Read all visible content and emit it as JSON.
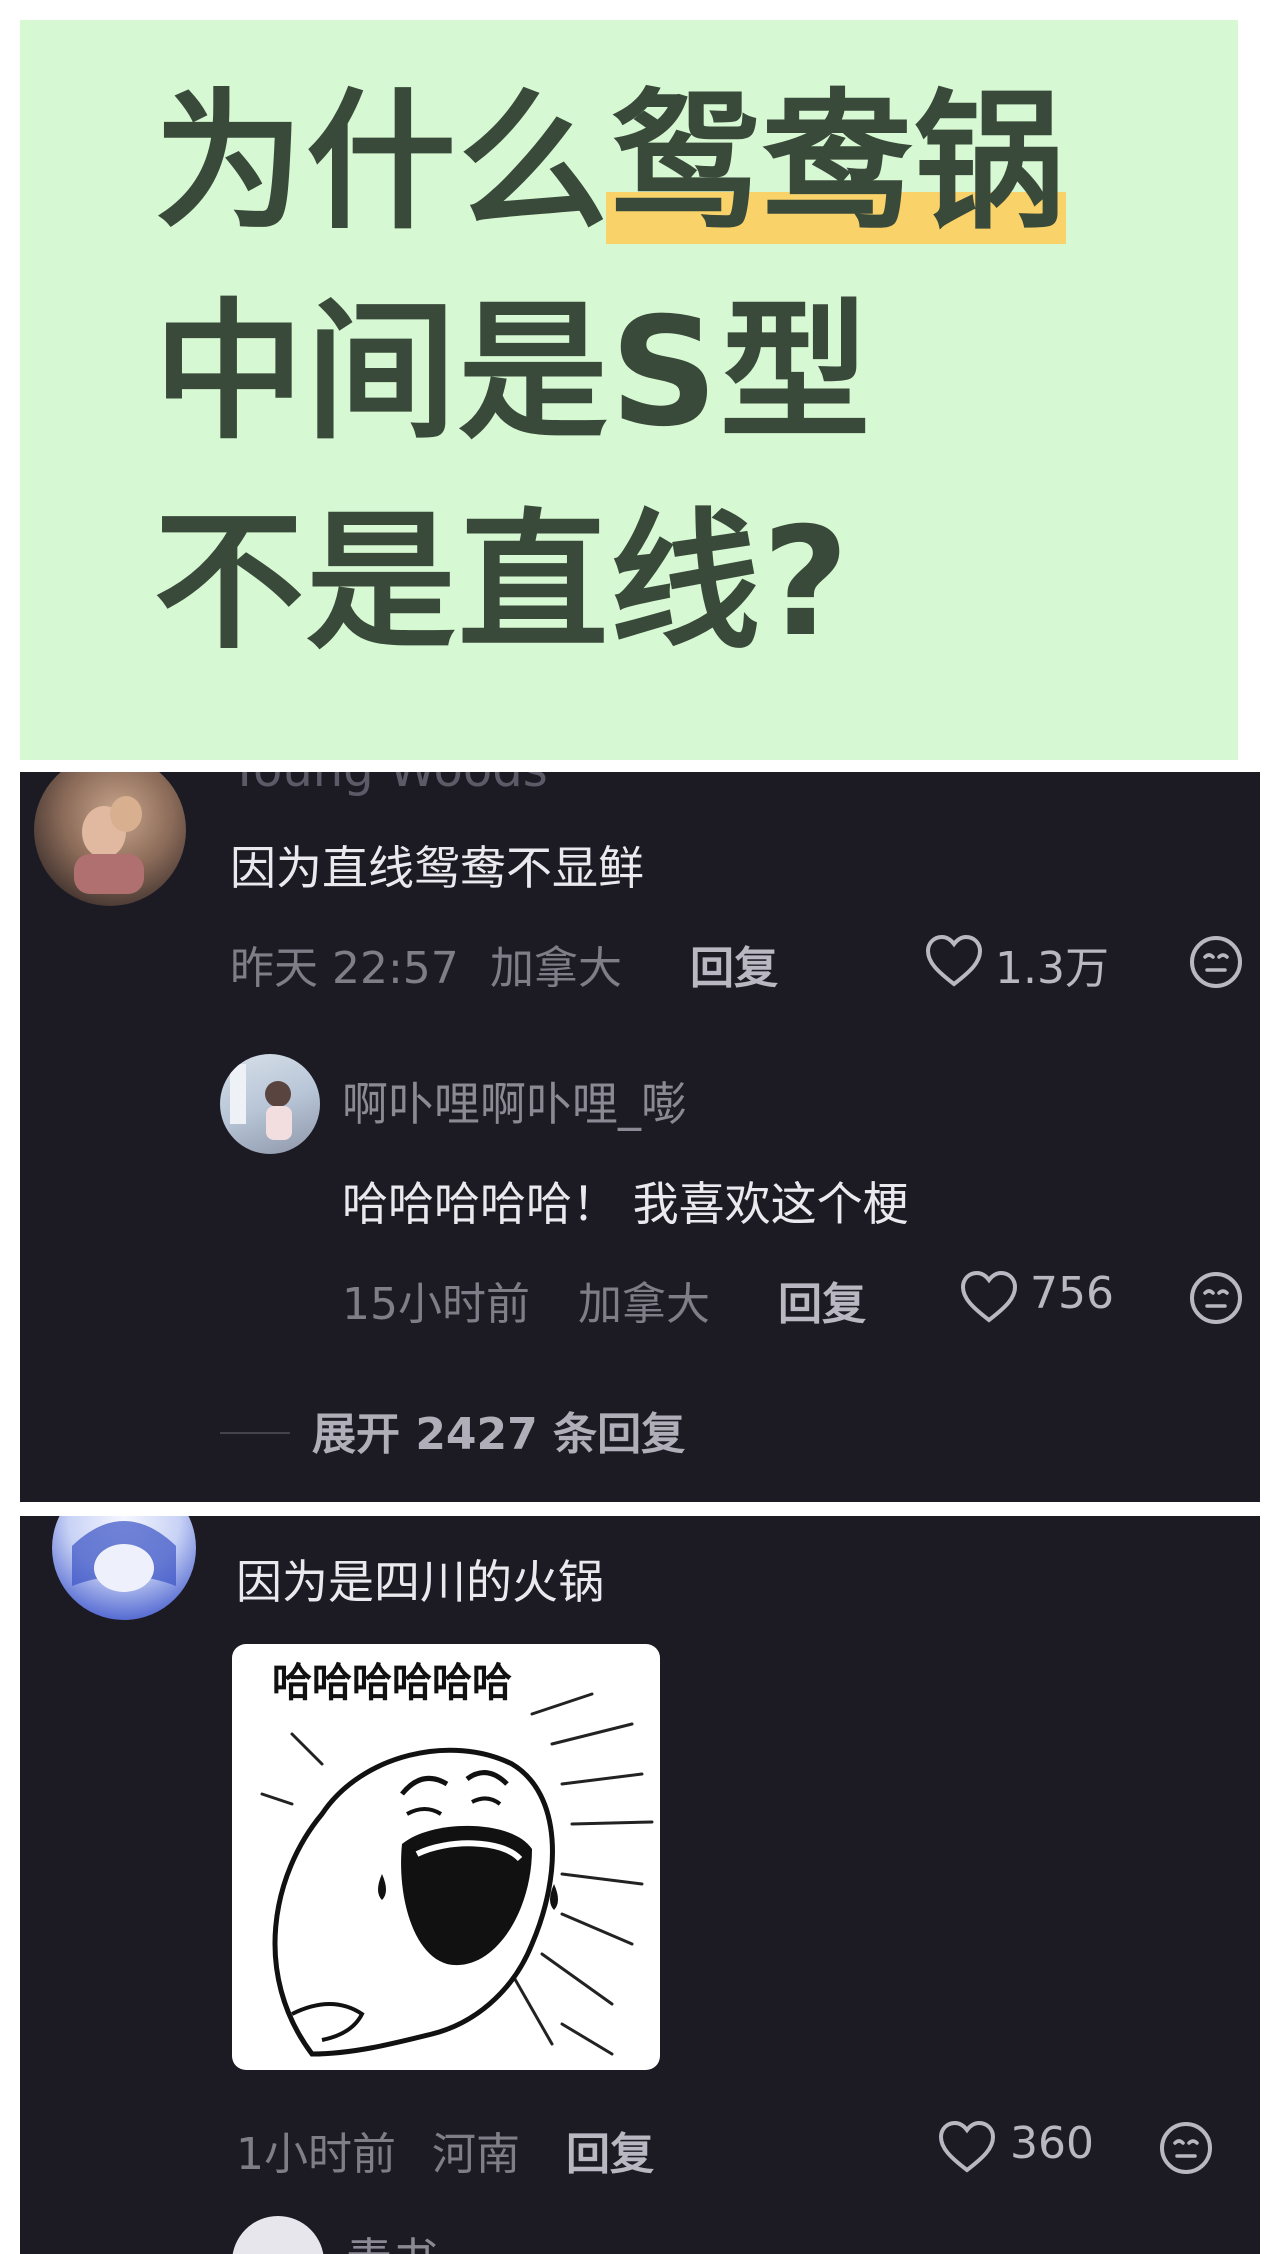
{
  "title_card": {
    "line1_prefix": "为什么",
    "line1_highlight": "鸳鸯锅",
    "line2": "中间是S型",
    "line3": "不是直线?",
    "bg_color": "#d6f8d2",
    "highlight_color": "#f9d26a"
  },
  "comments": [
    {
      "partial_username": "Young Woods",
      "text": "因为直线鸳鸯不显鲜",
      "time": "昨天 22:57",
      "location": "加拿大",
      "reply_label": "回复",
      "likes": "1.3万",
      "replies": [
        {
          "username": "啊卟哩啊卟哩_嘭",
          "text": "哈哈哈哈哈！ 我喜欢这个梗",
          "time": "15小时前",
          "location": "加拿大",
          "reply_label": "回复",
          "likes": "756"
        }
      ],
      "expand_label": "展开 2427 条回复"
    },
    {
      "text": "因为是四川的火锅",
      "sticker_caption": "哈哈哈哈哈哈",
      "time": "1小时前",
      "location": "河南",
      "reply_label": "回复",
      "likes": "360",
      "next_partial_username": "青书"
    }
  ],
  "icons": {
    "like": "heart-outline-icon",
    "menu": "neutral-face-icon"
  },
  "colors": {
    "panel_bg": "#1c1b24",
    "primary_text": "#e9e9ee",
    "secondary_text": "#7e7d88"
  }
}
